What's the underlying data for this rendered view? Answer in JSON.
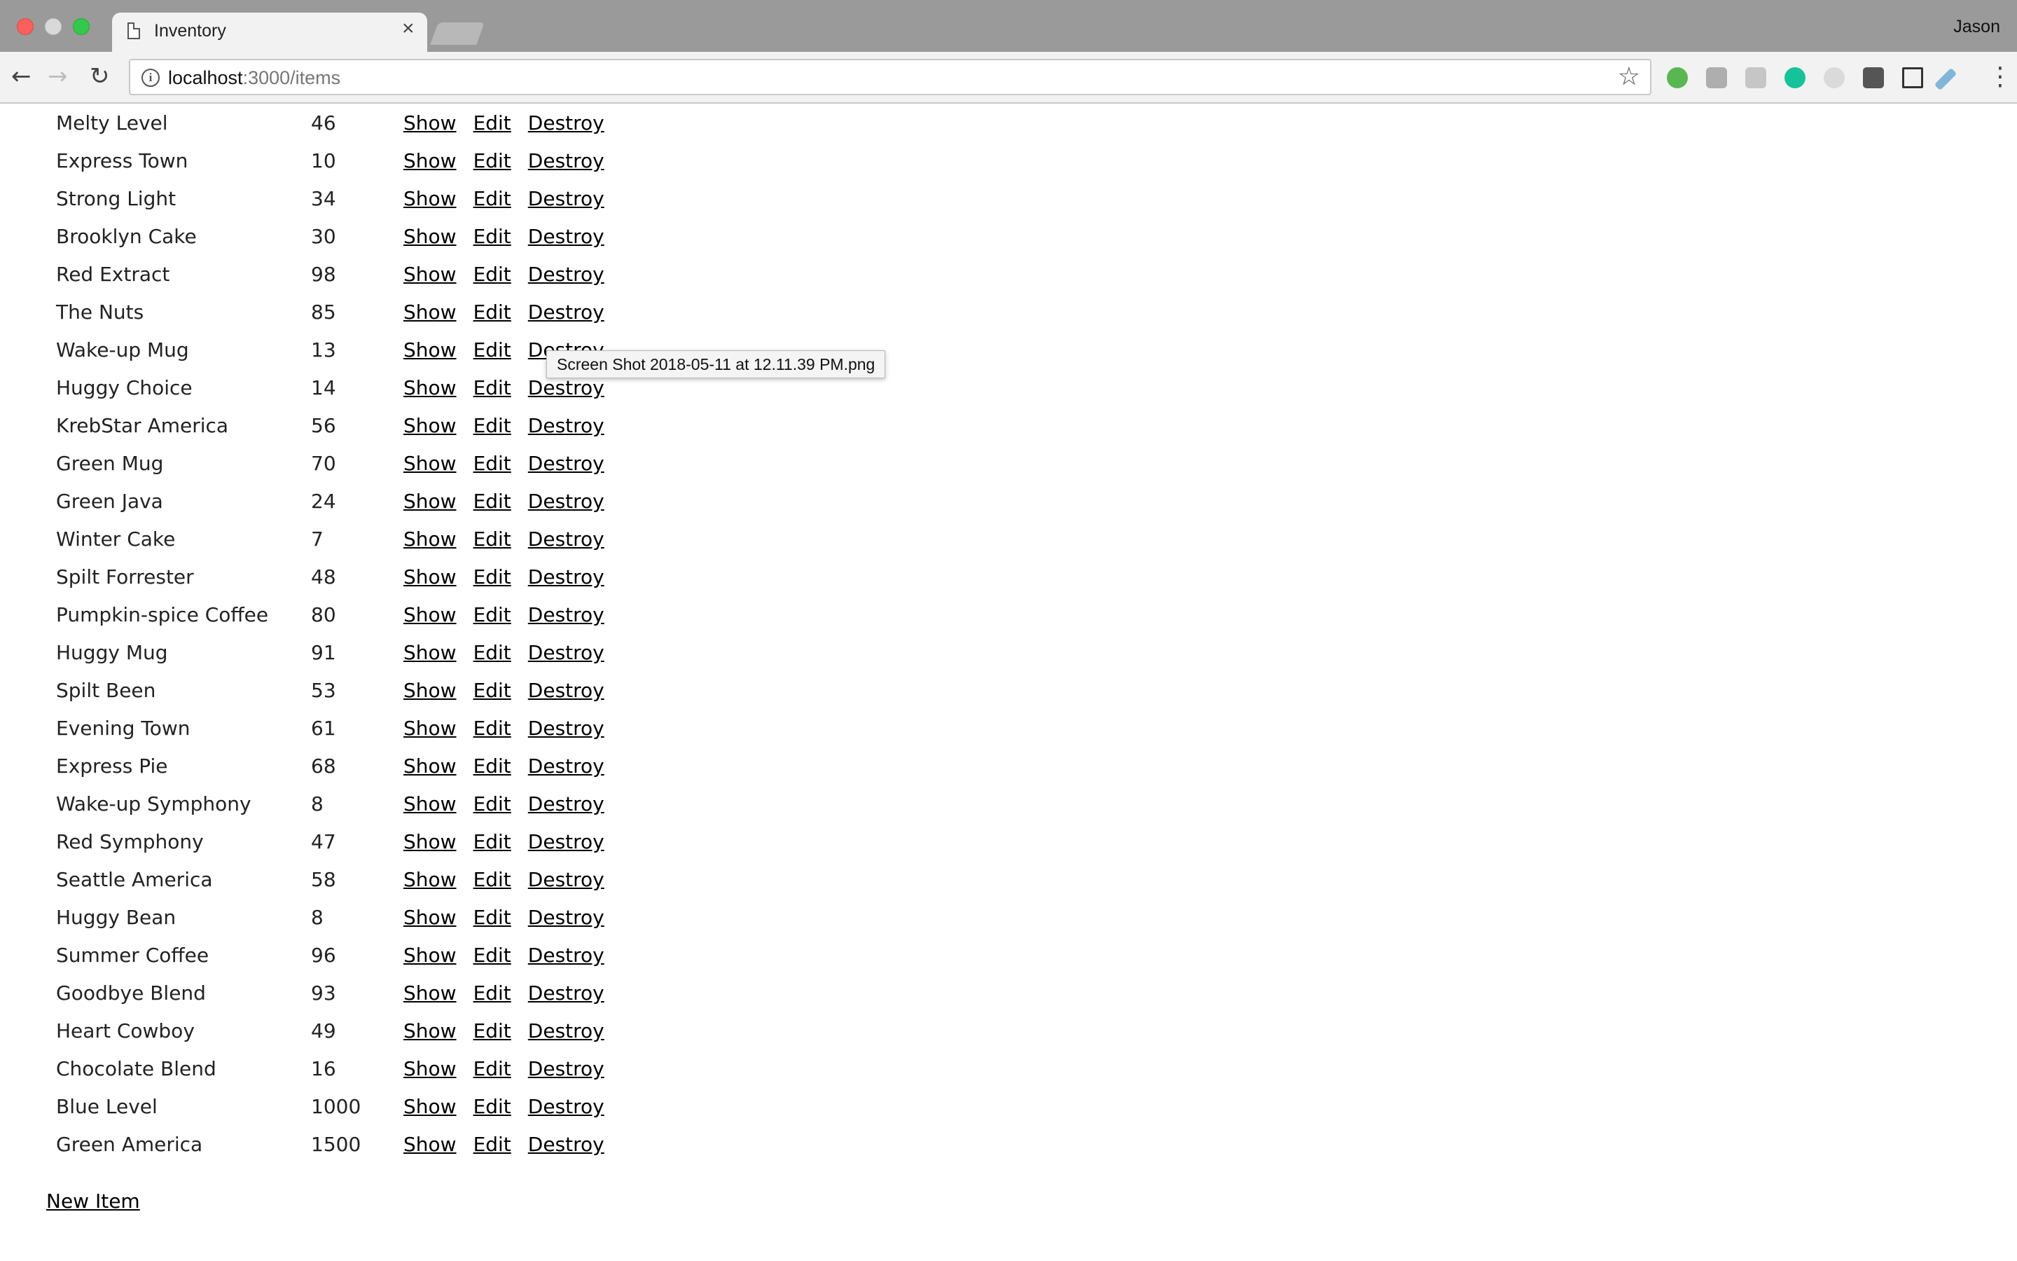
{
  "browser": {
    "tab_title": "Inventory",
    "tab_close": "×",
    "profile_name": "Jason",
    "url_host": "localhost",
    "url_path": ":3000/items"
  },
  "items": [
    {
      "name": "Melty Level",
      "qty": "46"
    },
    {
      "name": "Express Town",
      "qty": "10"
    },
    {
      "name": "Strong Light",
      "qty": "34"
    },
    {
      "name": "Brooklyn Cake",
      "qty": "30"
    },
    {
      "name": "Red Extract",
      "qty": "98"
    },
    {
      "name": "The Nuts",
      "qty": "85"
    },
    {
      "name": "Wake-up Mug",
      "qty": "13"
    },
    {
      "name": "Huggy Choice",
      "qty": "14"
    },
    {
      "name": "KrebStar America",
      "qty": "56"
    },
    {
      "name": "Green Mug",
      "qty": "70"
    },
    {
      "name": "Green Java",
      "qty": "24"
    },
    {
      "name": "Winter Cake",
      "qty": "7"
    },
    {
      "name": "Spilt Forrester",
      "qty": "48"
    },
    {
      "name": "Pumpkin-spice Coffee",
      "qty": "80"
    },
    {
      "name": "Huggy Mug",
      "qty": "91"
    },
    {
      "name": "Spilt Been",
      "qty": "53"
    },
    {
      "name": "Evening Town",
      "qty": "61"
    },
    {
      "name": "Express Pie",
      "qty": "68"
    },
    {
      "name": "Wake-up Symphony",
      "qty": "8"
    },
    {
      "name": "Red Symphony",
      "qty": "47"
    },
    {
      "name": "Seattle America",
      "qty": "58"
    },
    {
      "name": "Huggy Bean",
      "qty": "8"
    },
    {
      "name": "Summer Coffee",
      "qty": "96"
    },
    {
      "name": "Goodbye Blend",
      "qty": "93"
    },
    {
      "name": "Heart Cowboy",
      "qty": "49"
    },
    {
      "name": "Chocolate Blend",
      "qty": "16"
    },
    {
      "name": "Blue Level",
      "qty": "1000"
    },
    {
      "name": "Green America",
      "qty": "1500"
    }
  ],
  "actions": {
    "show": "Show",
    "edit": "Edit",
    "destroy": "Destroy"
  },
  "new_item_label": "New Item",
  "tooltip_text": "Screen Shot 2018-05-11 at 12.11.39 PM.png"
}
